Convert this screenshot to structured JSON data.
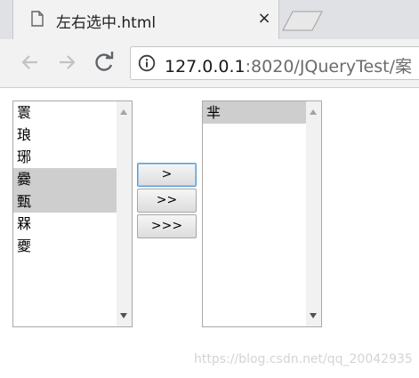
{
  "browser": {
    "tab_title": "左右选中.html",
    "close_glyph": "×",
    "url_host": "127.0.0.1",
    "url_rest": ":8020/JQueryTest/案"
  },
  "page": {
    "left_list": {
      "items": [
        {
          "label": "瞏",
          "selected": false
        },
        {
          "label": "琅",
          "selected": false
        },
        {
          "label": "琊",
          "selected": false
        },
        {
          "label": "爨",
          "selected": true
        },
        {
          "label": "甄",
          "selected": true
        },
        {
          "label": "槑",
          "selected": false
        },
        {
          "label": "夒",
          "selected": false
        }
      ]
    },
    "right_list": {
      "items": [
        {
          "label": "芈",
          "selected": true
        }
      ]
    },
    "buttons": {
      "move_selected": ">",
      "move_all": ">>",
      "move_third": ">>>"
    }
  },
  "watermark": "https://blog.csdn.net/qq_20042935"
}
